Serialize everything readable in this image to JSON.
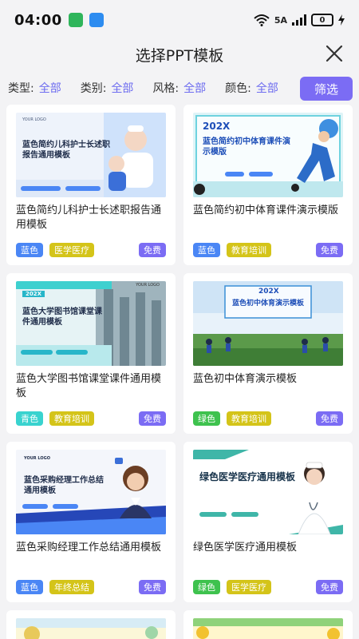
{
  "status_bar": {
    "time": "04:00",
    "network": "5A",
    "battery": "0"
  },
  "header": {
    "title": "选择PPT模板"
  },
  "filters": [
    {
      "label": "类型:",
      "value": "全部"
    },
    {
      "label": "类别:",
      "value": "全部"
    },
    {
      "label": "风格:",
      "value": "全部"
    },
    {
      "label": "颜色:",
      "value": "全部"
    }
  ],
  "filter_button": "筛选",
  "cards": [
    {
      "title": "蓝色简约儿科护士长述职报告通用模板",
      "color_tag": "蓝色",
      "color_hex": "#4a86f5",
      "category_tag": "医学医疗",
      "category_hex": "#d4c419",
      "price": "免费",
      "thumb": {
        "logo": "YOUR LOGO",
        "heading": "蓝色简约儿科护士长述职报告通用模板"
      }
    },
    {
      "title": "蓝色简约初中体育课件演示模版",
      "color_tag": "蓝色",
      "color_hex": "#4a86f5",
      "category_tag": "教育培训",
      "category_hex": "#d4c419",
      "price": "免费",
      "thumb": {
        "year": "202X",
        "heading": "蓝色简约初中体育课件演示模版"
      }
    },
    {
      "title": "蓝色大学图书馆课堂课件通用模板",
      "color_tag": "青色",
      "color_hex": "#39d3cf",
      "category_tag": "教育培训",
      "category_hex": "#d4c419",
      "price": "免费",
      "thumb": {
        "year": "202X",
        "heading": "蓝色大学图书馆课堂课件通用模板",
        "logo": "YOUR LOGO"
      }
    },
    {
      "title": "蓝色初中体育演示模板",
      "color_tag": "绿色",
      "color_hex": "#3ec24e",
      "category_tag": "教育培训",
      "category_hex": "#d4c419",
      "price": "免费",
      "thumb": {
        "year": "202X",
        "heading": "蓝色初中体育演示模板"
      }
    },
    {
      "title": "蓝色采购经理工作总结通用模板",
      "color_tag": "蓝色",
      "color_hex": "#4a86f5",
      "category_tag": "年终总结",
      "category_hex": "#d4c419",
      "price": "免费",
      "thumb": {
        "logo": "YOUR LOGO",
        "heading": "蓝色采购经理工作总结通用模板"
      }
    },
    {
      "title": "绿色医学医疗通用模板",
      "color_tag": "绿色",
      "color_hex": "#3ec24e",
      "category_tag": "医学医疗",
      "category_hex": "#d4c419",
      "price": "免费",
      "thumb": {
        "heading": "绿色医学医疗通用模板"
      }
    }
  ]
}
